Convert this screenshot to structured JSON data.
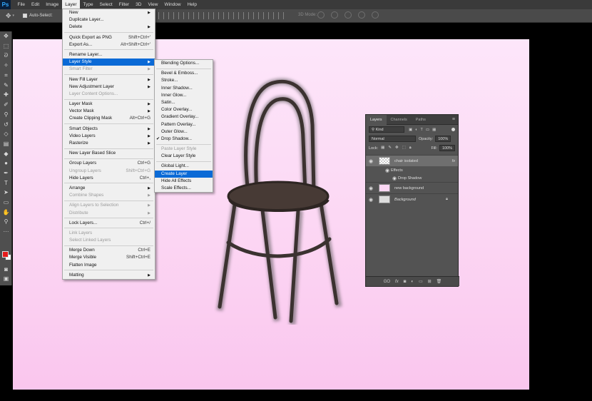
{
  "app": {
    "logo": "Ps"
  },
  "menubar": [
    "File",
    "Edit",
    "Image",
    "Layer",
    "Type",
    "Select",
    "Filter",
    "3D",
    "View",
    "Window",
    "Help"
  ],
  "options": {
    "auto_select": "Auto-Select:",
    "mode3d": "3D Mode:"
  },
  "layer_menu": [
    {
      "label": "New",
      "arrow": true
    },
    {
      "label": "Duplicate Layer..."
    },
    {
      "label": "Delete",
      "arrow": true
    },
    {
      "sep": true
    },
    {
      "label": "Quick Export as PNG",
      "shortcut": "Shift+Ctrl+'"
    },
    {
      "label": "Export As...",
      "shortcut": "Alt+Shift+Ctrl+'"
    },
    {
      "sep": true
    },
    {
      "label": "Rename Layer..."
    },
    {
      "label": "Layer Style",
      "arrow": true,
      "selected": true
    },
    {
      "label": "Smart Filter",
      "arrow": true,
      "disabled": true
    },
    {
      "sep": true
    },
    {
      "label": "New Fill Layer",
      "arrow": true
    },
    {
      "label": "New Adjustment Layer",
      "arrow": true
    },
    {
      "label": "Layer Content Options...",
      "disabled": true
    },
    {
      "sep": true
    },
    {
      "label": "Layer Mask",
      "arrow": true
    },
    {
      "label": "Vector Mask",
      "arrow": true
    },
    {
      "label": "Create Clipping Mask",
      "shortcut": "Alt+Ctrl+G"
    },
    {
      "sep": true
    },
    {
      "label": "Smart Objects",
      "arrow": true
    },
    {
      "label": "Video Layers",
      "arrow": true
    },
    {
      "label": "Rasterize",
      "arrow": true
    },
    {
      "sep": true
    },
    {
      "label": "New Layer Based Slice"
    },
    {
      "sep": true
    },
    {
      "label": "Group Layers",
      "shortcut": "Ctrl+G"
    },
    {
      "label": "Ungroup Layers",
      "shortcut": "Shift+Ctrl+G",
      "disabled": true
    },
    {
      "label": "Hide Layers",
      "shortcut": "Ctrl+,"
    },
    {
      "sep": true
    },
    {
      "label": "Arrange",
      "arrow": true
    },
    {
      "label": "Combine Shapes",
      "arrow": true,
      "disabled": true
    },
    {
      "sep": true
    },
    {
      "label": "Align Layers to Selection",
      "arrow": true,
      "disabled": true
    },
    {
      "label": "Distribute",
      "arrow": true,
      "disabled": true
    },
    {
      "sep": true
    },
    {
      "label": "Lock Layers...",
      "shortcut": "Ctrl+/"
    },
    {
      "sep": true
    },
    {
      "label": "Link Layers",
      "disabled": true
    },
    {
      "label": "Select Linked Layers",
      "disabled": true
    },
    {
      "sep": true
    },
    {
      "label": "Merge Down",
      "shortcut": "Ctrl+E"
    },
    {
      "label": "Merge Visible",
      "shortcut": "Shift+Ctrl+E"
    },
    {
      "label": "Flatten Image"
    },
    {
      "sep": true
    },
    {
      "label": "Matting",
      "arrow": true
    }
  ],
  "style_submenu": [
    {
      "label": "Blending Options..."
    },
    {
      "sep": true
    },
    {
      "label": "Bevel & Emboss..."
    },
    {
      "label": "Stroke..."
    },
    {
      "label": "Inner Shadow..."
    },
    {
      "label": "Inner Glow..."
    },
    {
      "label": "Satin..."
    },
    {
      "label": "Color Overlay..."
    },
    {
      "label": "Gradient Overlay..."
    },
    {
      "label": "Pattern Overlay..."
    },
    {
      "label": "Outer Glow..."
    },
    {
      "label": "Drop Shadow...",
      "checked": true
    },
    {
      "sep": true
    },
    {
      "label": "Paste Layer Style",
      "disabled": true
    },
    {
      "label": "Clear Layer Style"
    },
    {
      "sep": true
    },
    {
      "label": "Global Light..."
    },
    {
      "label": "Create Layer",
      "selected": true
    },
    {
      "label": "Hide All Effects"
    },
    {
      "label": "Scale Effects..."
    }
  ],
  "layers_panel": {
    "tabs": [
      "Layers",
      "Channels",
      "Paths"
    ],
    "filter": "Kind",
    "blend_mode": "Normal",
    "opacity_label": "Opacity:",
    "opacity_value": "100%",
    "lock_label": "Lock:",
    "fill_label": "Fill:",
    "fill_value": "100%",
    "layers": [
      {
        "name": "chair isolated",
        "fx": "fx",
        "selected": true
      },
      {
        "name": "new background"
      },
      {
        "name": "Background",
        "italic": true
      }
    ],
    "effects_label": "Effects",
    "effect_item": "Drop Shadow",
    "bottom_icons": [
      "GO",
      "fx"
    ]
  }
}
